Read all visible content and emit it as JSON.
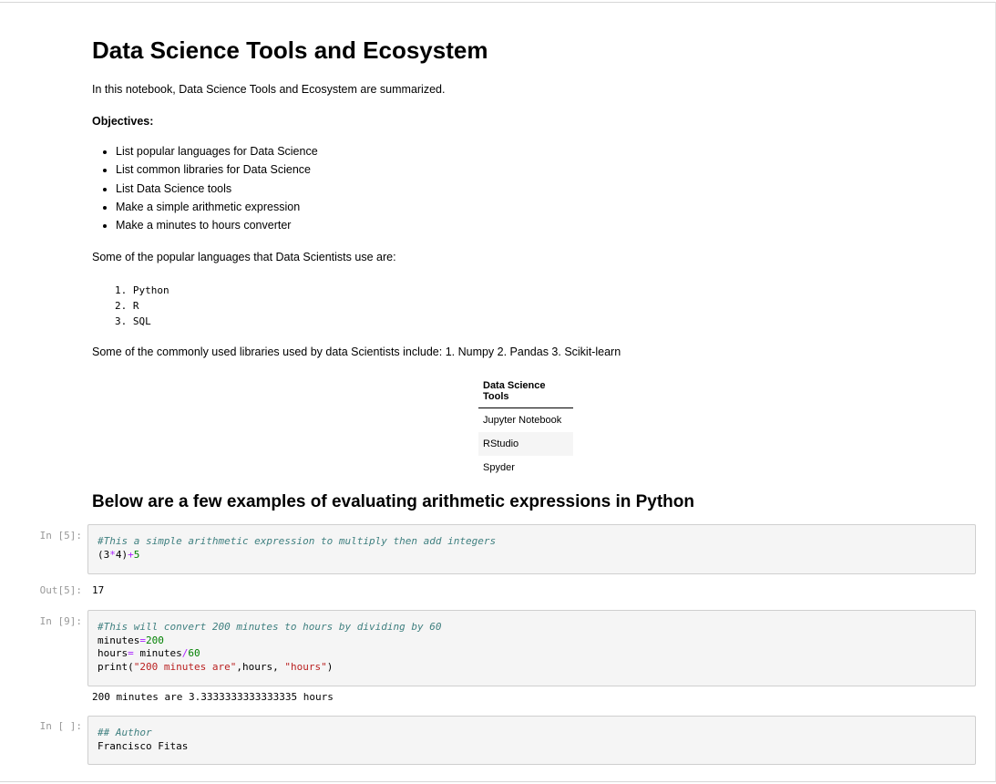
{
  "title": "Data Science Tools and Ecosystem",
  "intro": "In this notebook, Data Science Tools and Ecosystem are summarized.",
  "objectives_label": "Objectives:",
  "objectives": [
    "List popular languages for Data Science",
    "List common libraries for Data Science",
    "List Data Science tools",
    "Make a simple arithmetic expression",
    "Make a minutes to hours converter"
  ],
  "languages_intro": "Some of the popular languages that Data Scientists use are:",
  "languages": [
    "1. Python",
    "2. R",
    "3. SQL"
  ],
  "libraries_text": "Some of the commonly used libraries used by data Scientists include: 1. Numpy 2. Pandas 3. Scikit-learn",
  "tools_table": {
    "header": "Data Science Tools",
    "rows": [
      "Jupyter Notebook",
      "RStudio",
      "Spyder"
    ]
  },
  "section_heading": "Below are a few examples of evaluating arithmetic expressions in Python",
  "cells": [
    {
      "prompt": "In [5]:",
      "comment": "#This a simple arithmetic expression to multiply then add integers",
      "line2_a": "(3",
      "line2_op1": "*",
      "line2_b": "4)",
      "line2_op2": "+",
      "line2_c": "5",
      "out_prompt": "Out[5]:",
      "output": "17"
    },
    {
      "prompt": "In [9]:",
      "comment": "#This will convert 200 minutes to hours by dividing by 60",
      "line2_a": "minutes",
      "line2_op": "=",
      "line2_num": "200",
      "line3_a": "hours",
      "line3_op": "=",
      "line3_b": " minutes",
      "line3_op2": "/",
      "line3_num": "60",
      "line4_a": "print(",
      "line4_str1": "\"200 minutes are\"",
      "line4_b": ",hours, ",
      "line4_str2": "\"hours\"",
      "line4_c": ")",
      "output": "200 minutes are 3.3333333333333335 hours"
    },
    {
      "prompt": "In [ ]:",
      "comment": "## Author",
      "line2": "Francisco Fitas"
    }
  ],
  "colors": {
    "comment": "#408080",
    "number": "#008000",
    "string": "#ba2121",
    "cell_bg": "#f5f5f5",
    "prompt": "#999999"
  }
}
